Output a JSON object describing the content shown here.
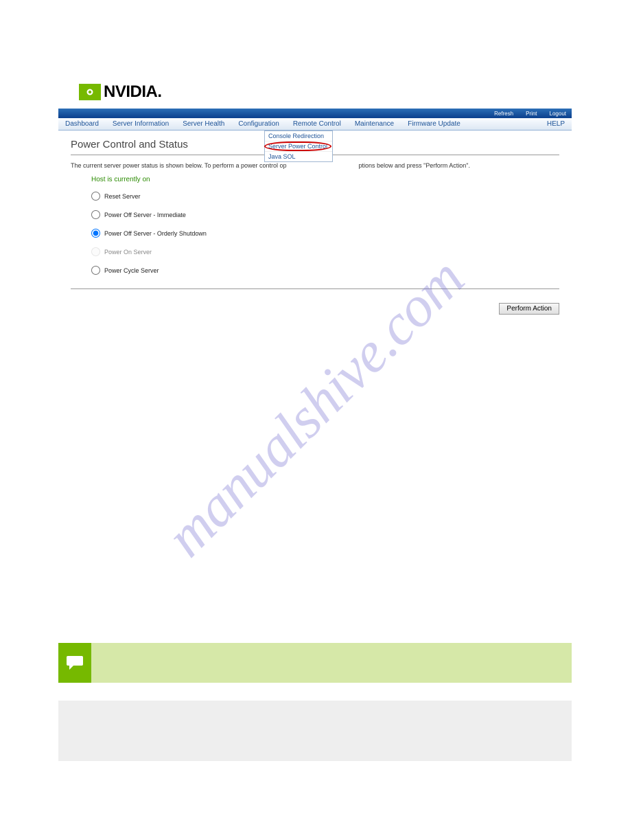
{
  "logo": {
    "brand_text": "NVIDIA",
    "dot": "."
  },
  "topbar": {
    "refresh": "Refresh",
    "print": "Print",
    "logout": "Logout"
  },
  "menu": {
    "dashboard": "Dashboard",
    "server_info": "Server Information",
    "server_health": "Server Health",
    "configuration": "Configuration",
    "remote_control": "Remote Control",
    "maintenance": "Maintenance",
    "firmware_update": "Firmware Update",
    "help": "HELP"
  },
  "dropdown": {
    "console_redirection": "Console Redirection",
    "server_power_control": "Server Power Control",
    "java_sol": "Java SOL"
  },
  "page_title": "Power Control and Status",
  "description_prefix": "The current server power status is shown below. To perform a power control op",
  "description_suffix": "ptions below and press \"Perform Action\".",
  "host_status": "Host is currently on",
  "options": {
    "reset": "Reset Server",
    "off_immediate": "Power Off Server - Immediate",
    "off_orderly": "Power Off Server - Orderly Shutdown",
    "on": "Power On Server",
    "cycle": "Power Cycle Server"
  },
  "action_button": "Perform Action",
  "watermark": "manualshive.com",
  "note_box": {
    "text": ""
  },
  "section_heading": "",
  "procedure": {
    "items": [
      "",
      "",
      ""
    ]
  }
}
